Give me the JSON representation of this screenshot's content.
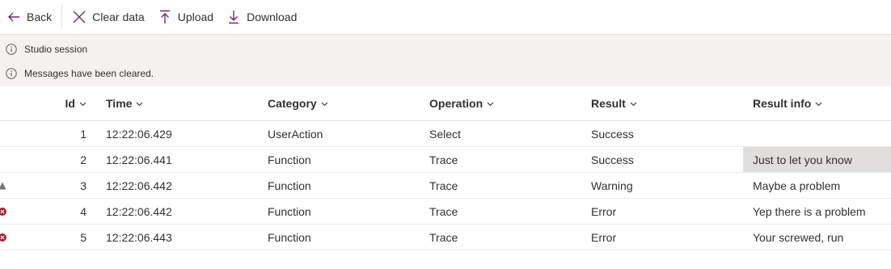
{
  "toolbar": {
    "back_label": "Back",
    "clear_label": "Clear data",
    "upload_label": "Upload",
    "download_label": "Download"
  },
  "info": {
    "session": "Studio session",
    "cleared": "Messages have been cleared."
  },
  "grid": {
    "headers": {
      "id": "Id",
      "time": "Time",
      "category": "Category",
      "operation": "Operation",
      "result": "Result",
      "result_info": "Result info"
    },
    "rows": [
      {
        "status": "",
        "id": "1",
        "time": "12:22:06.429",
        "category": "UserAction",
        "operation": "Select",
        "result": "Success",
        "result_info": ""
      },
      {
        "status": "",
        "id": "2",
        "time": "12:22:06.441",
        "category": "Function",
        "operation": "Trace",
        "result": "Success",
        "result_info": "Just to let you know"
      },
      {
        "status": "warning-icon",
        "id": "3",
        "time": "12:22:06.442",
        "category": "Function",
        "operation": "Trace",
        "result": "Warning",
        "result_info": "Maybe a problem"
      },
      {
        "status": "error-icon",
        "id": "4",
        "time": "12:22:06.442",
        "category": "Function",
        "operation": "Trace",
        "result": "Error",
        "result_info": "Yep there is a problem"
      },
      {
        "status": "error-icon",
        "id": "5",
        "time": "12:22:06.443",
        "category": "Function",
        "operation": "Trace",
        "result": "Error",
        "result_info": "Your screwed, run"
      }
    ]
  },
  "colors": {
    "accent": "#742774",
    "warning": "#797775",
    "error": "#a4262c"
  }
}
